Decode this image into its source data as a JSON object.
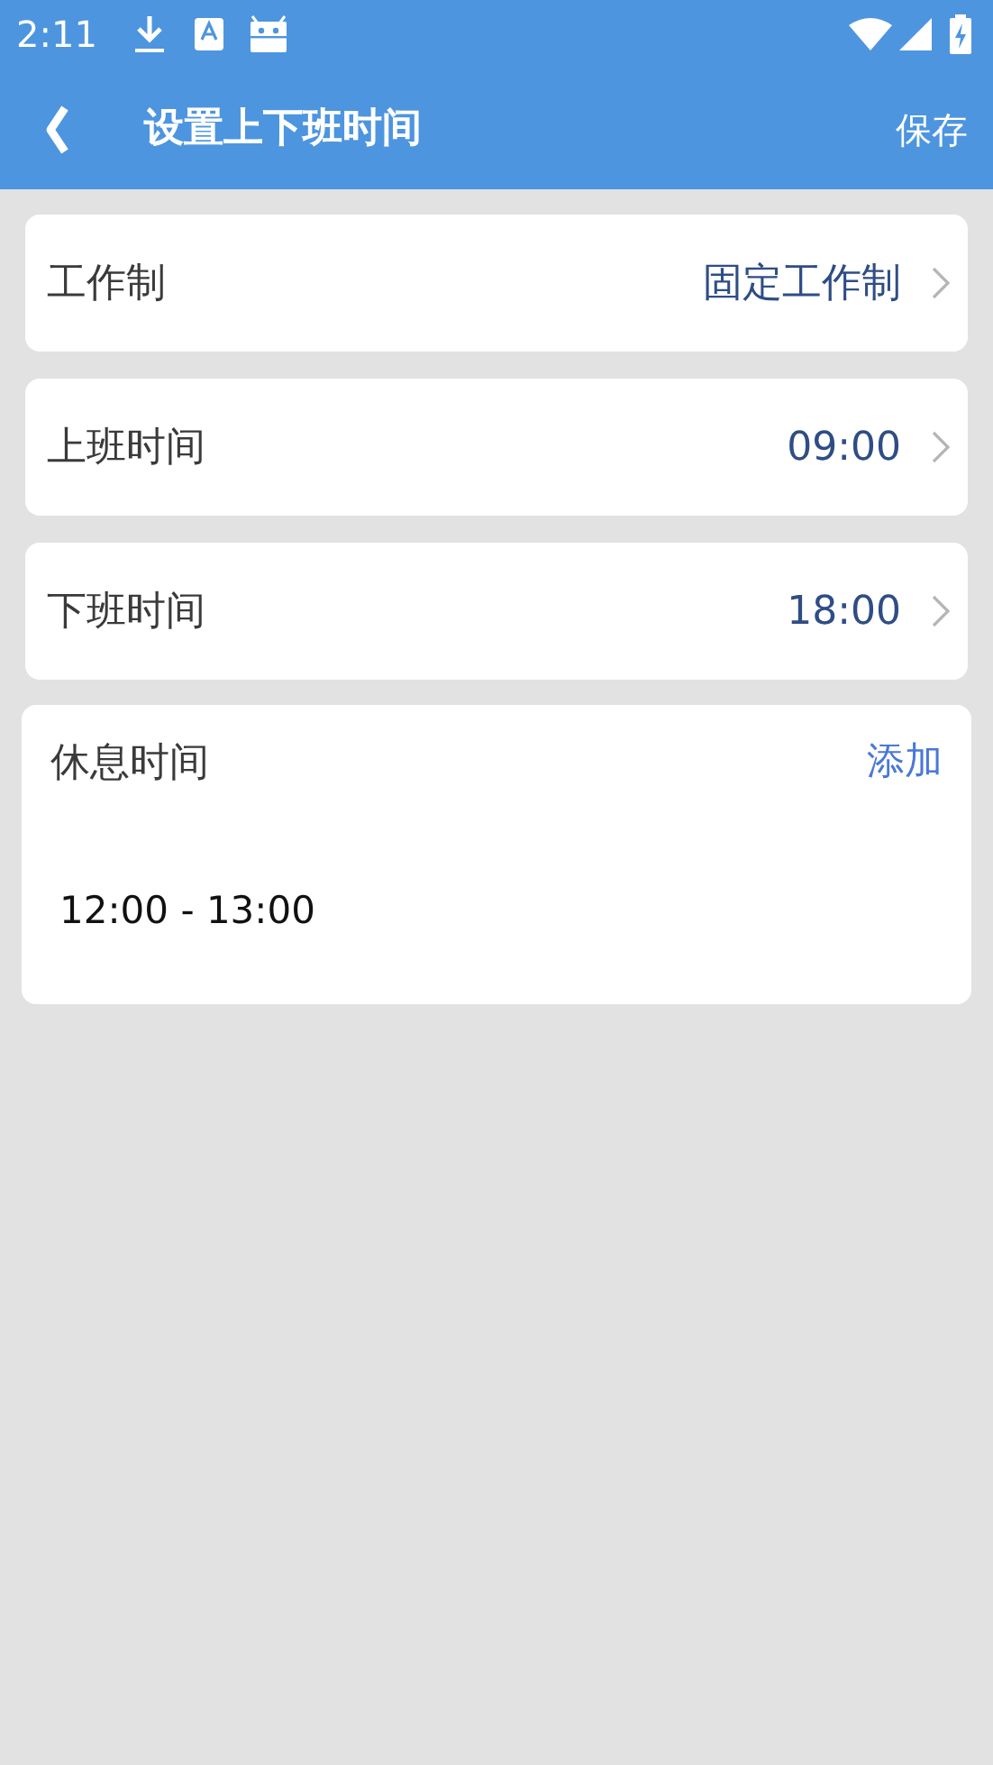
{
  "status_bar": {
    "time": "2:11"
  },
  "header": {
    "title": "设置上下班时间",
    "action": "保存"
  },
  "settings": [
    {
      "label": "工作制",
      "value": "固定工作制"
    },
    {
      "label": "上班时间",
      "value": "09:00"
    },
    {
      "label": "下班时间",
      "value": "18:00"
    }
  ],
  "break_section": {
    "title": "休息时间",
    "action": "添加",
    "periods": [
      "12:00 - 13:00"
    ]
  }
}
